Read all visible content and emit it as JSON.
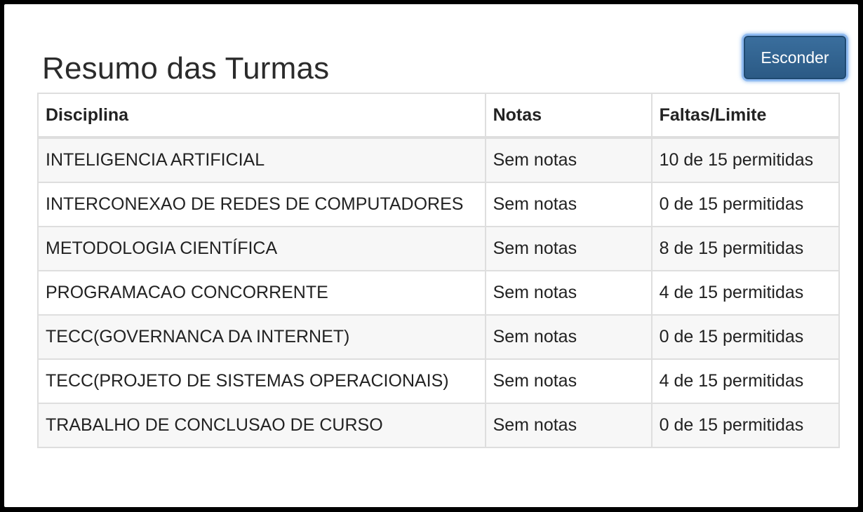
{
  "panel": {
    "title": "Resumo das Turmas",
    "hide_button_label": "Esconder"
  },
  "table": {
    "headers": {
      "disciplina": "Disciplina",
      "notas": "Notas",
      "faltas": "Faltas/Limite"
    },
    "rows": [
      {
        "disciplina": "INTELIGENCIA ARTIFICIAL",
        "notas": "Sem notas",
        "faltas": "10 de 15 permitidas"
      },
      {
        "disciplina": "INTERCONEXAO DE REDES DE COMPUTADORES",
        "notas": "Sem notas",
        "faltas": "0 de 15 permitidas"
      },
      {
        "disciplina": "METODOLOGIA CIENTÍFICA",
        "notas": "Sem notas",
        "faltas": "8 de 15 permitidas"
      },
      {
        "disciplina": "PROGRAMACAO CONCORRENTE",
        "notas": "Sem notas",
        "faltas": "4 de 15 permitidas"
      },
      {
        "disciplina": "TECC(GOVERNANCA DA INTERNET)",
        "notas": "Sem notas",
        "faltas": "0 de 15 permitidas"
      },
      {
        "disciplina": "TECC(PROJETO DE SISTEMAS OPERACIONAIS)",
        "notas": "Sem notas",
        "faltas": "4 de 15 permitidas"
      },
      {
        "disciplina": "TRABALHO DE CONCLUSAO DE CURSO",
        "notas": "Sem notas",
        "faltas": "0 de 15 permitidas"
      }
    ]
  },
  "colors": {
    "button_bg": "#2b5a85",
    "button_focus_ring": "#8fbaf0",
    "row_stripe": "#f7f7f7",
    "border": "#dedede"
  }
}
